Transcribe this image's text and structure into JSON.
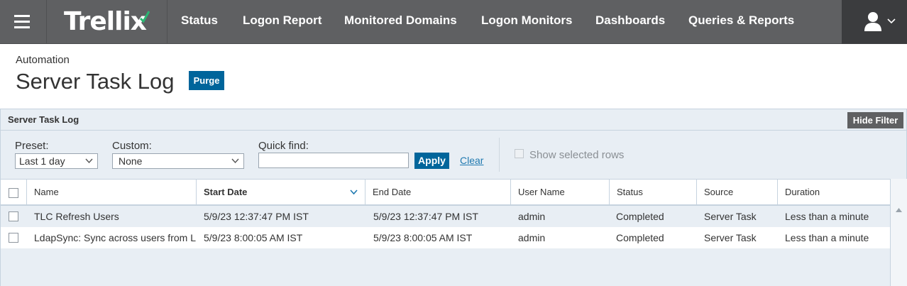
{
  "nav": {
    "logo": "Trellix",
    "items": [
      "Status",
      "Logon Report",
      "Monitored Domains",
      "Logon Monitors",
      "Dashboards",
      "Queries & Reports"
    ]
  },
  "page": {
    "breadcrumb": "Automation",
    "title": "Server Task Log",
    "purge_label": "Purge"
  },
  "panel": {
    "title": "Server Task Log",
    "hide_filter_label": "Hide Filter"
  },
  "filters": {
    "preset_label": "Preset:",
    "preset_value": "Last 1 day",
    "custom_label": "Custom:",
    "custom_value": "None",
    "quickfind_label": "Quick find:",
    "quickfind_value": "",
    "apply_label": "Apply",
    "clear_label": "Clear",
    "show_selected_label": "Show selected rows"
  },
  "table": {
    "columns": [
      "Name",
      "Start Date",
      "End Date",
      "User Name",
      "Status",
      "Source",
      "Duration"
    ],
    "rows": [
      [
        "TLC Refresh Users",
        "5/9/23 12:37:47 PM IST",
        "5/9/23 12:37:47 PM IST",
        "admin",
        "Completed",
        "Server Task",
        "Less than a minute"
      ],
      [
        "LdapSync: Sync across users from L",
        "5/9/23 8:00:05 AM IST",
        "5/9/23 8:00:05 AM IST",
        "admin",
        "Completed",
        "Server Task",
        "Less than a minute"
      ]
    ]
  },
  "colors": {
    "nav_bg": "#5f6062",
    "accent": "#00659b",
    "panel_bg": "#e8eef4"
  },
  "icons": [
    "hamburger-icon",
    "logo-check-icon",
    "user-icon",
    "chevron-down-icon",
    "sort-desc-icon",
    "scroll-up-icon"
  ]
}
